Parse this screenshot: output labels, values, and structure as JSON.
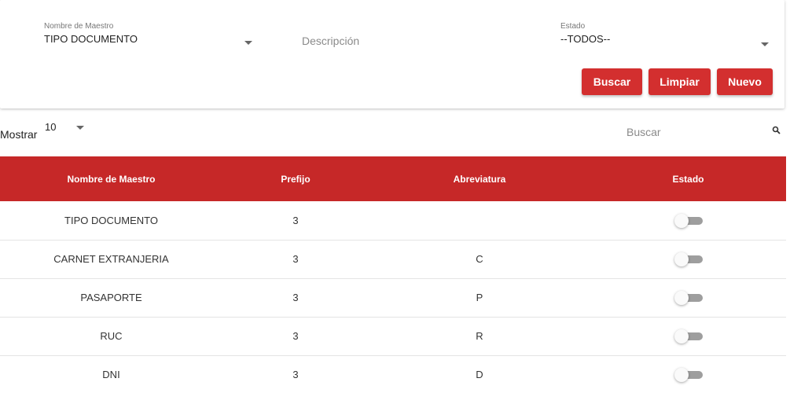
{
  "filters": {
    "maestro_label": "Nombre de Maestro",
    "maestro_value": "TIPO DOCUMENTO",
    "descripcion_placeholder": "Descripción",
    "estado_label": "Estado",
    "estado_value": "--TODOS--"
  },
  "actions": {
    "buscar": "Buscar",
    "limpiar": "Limpiar",
    "nuevo": "Nuevo"
  },
  "list_controls": {
    "mostrar_label": "Mostrar",
    "page_size": "10",
    "search_placeholder": "Buscar"
  },
  "table": {
    "headers": [
      "Nombre de Maestro",
      "Prefijo",
      "Abreviatura",
      "Estado"
    ],
    "rows": [
      {
        "nombre": "TIPO DOCUMENTO",
        "prefijo": "3",
        "abreviatura": "",
        "estado": false
      },
      {
        "nombre": "CARNET EXTRANJERIA",
        "prefijo": "3",
        "abreviatura": "C",
        "estado": false
      },
      {
        "nombre": "PASAPORTE",
        "prefijo": "3",
        "abreviatura": "P",
        "estado": false
      },
      {
        "nombre": "RUC",
        "prefijo": "3",
        "abreviatura": "R",
        "estado": false
      },
      {
        "nombre": "DNI",
        "prefijo": "3",
        "abreviatura": "D",
        "estado": false
      }
    ]
  },
  "colors": {
    "accent": "#d32f2f",
    "header_bg": "#c62828",
    "toggle_off": "#9e9e9e"
  }
}
